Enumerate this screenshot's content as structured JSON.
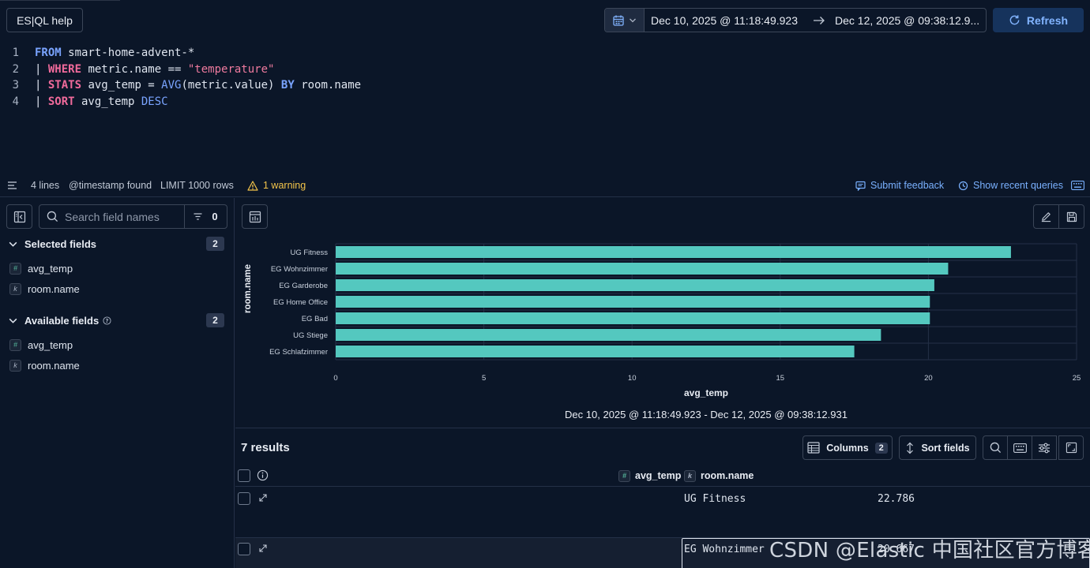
{
  "header": {
    "help_label": "ES|QL help",
    "date_start": "Dec 10, 2025 @ 11:18:49.923",
    "date_end": "Dec 12, 2025 @ 09:38:12.9...",
    "refresh_label": "Refresh"
  },
  "editor": {
    "line_numbers": [
      "1",
      "2",
      "3",
      "4"
    ],
    "l1": {
      "kw": "FROM",
      "rest": " smart-home-advent-*"
    },
    "l2": {
      "pipe": "| ",
      "kw": "WHERE",
      "mid": " metric.name == ",
      "str": "\"temperature\""
    },
    "l3": {
      "pipe": "| ",
      "kw": "STATS",
      "a": " avg_temp = ",
      "fn": "AVG",
      "b": "(metric.value) ",
      "by": "BY",
      "c": " room.name"
    },
    "l4": {
      "pipe": "| ",
      "kw": "SORT",
      "a": " avg_temp ",
      "desc": "DESC"
    }
  },
  "status": {
    "lines": "4 lines",
    "timestamp": "@timestamp found",
    "limit": "LIMIT 1000 rows",
    "warning": "1 warning",
    "feedback": "Submit feedback",
    "recent": "Show recent queries"
  },
  "sidebar": {
    "search_placeholder": "Search field names",
    "filter_count": "0",
    "selected": {
      "title": "Selected fields",
      "count": "2",
      "fields": [
        {
          "name": "avg_temp",
          "type": "#"
        },
        {
          "name": "room.name",
          "type": "k"
        }
      ]
    },
    "available": {
      "title": "Available fields",
      "count": "2",
      "fields": [
        {
          "name": "avg_temp",
          "type": "#"
        },
        {
          "name": "room.name",
          "type": "k"
        }
      ]
    }
  },
  "chart_data": {
    "type": "bar",
    "orientation": "horizontal",
    "categories": [
      "UG Fitness",
      "EG Wohnzimmer",
      "EG Garderobe",
      "EG Home Office",
      "EG Bad",
      "UG Stiege",
      "EG Schlafzimmer"
    ],
    "series": [
      {
        "values": [
          22.786,
          20.667,
          20.2,
          20.05,
          20.05,
          18.4,
          17.5
        ]
      }
    ],
    "xlabel": "avg_temp",
    "ylabel": "room.name",
    "xlim": [
      0,
      25
    ],
    "xticks": [
      0,
      5,
      10,
      15,
      20,
      25
    ],
    "grid": true,
    "bar_color": "#54c8bf",
    "time_range": "Dec 10, 2025 @ 11:18:49.923 - Dec 12, 2025 @ 09:38:12.931"
  },
  "results": {
    "count_label": "7 results",
    "columns_label": "Columns",
    "columns_count": "2",
    "sort_label": "Sort fields",
    "headers": {
      "avg_temp": "avg_temp",
      "room": "room.name"
    },
    "rows": [
      {
        "avg_temp": "22.786",
        "room": "UG Fitness"
      },
      {
        "avg_temp": "20.667",
        "room": "EG Wohnzimmer"
      }
    ]
  },
  "watermark": "CSDN @Elastic 中国社区官方博客",
  "colors": {
    "accent": "#82b4ff",
    "bar": "#54c8bf",
    "warning": "#f3c44a",
    "keyword": "#f06a9b"
  }
}
